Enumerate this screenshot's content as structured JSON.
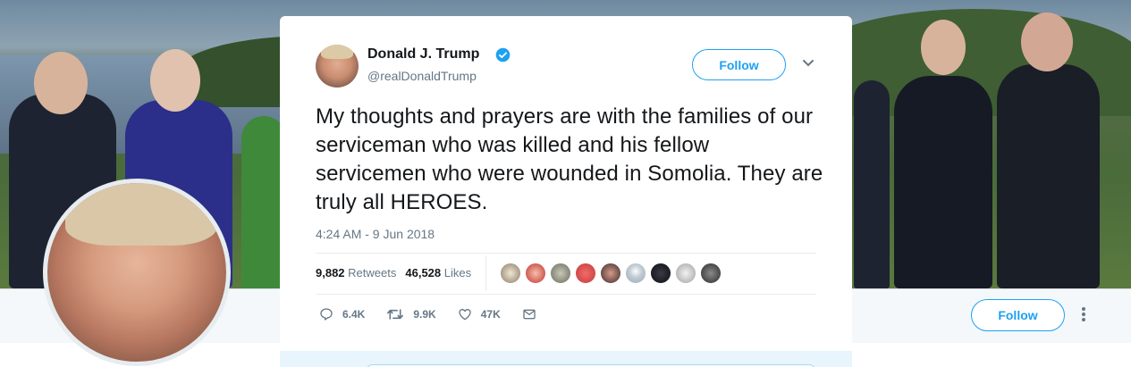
{
  "tweet": {
    "author_name": "Donald J. Trump",
    "author_handle": "@realDonaldTrump",
    "follow_label": "Follow",
    "text": "My thoughts and prayers are with the families of our serviceman who was killed and his fellow servicemen who were wounded in Somolia. They are truly all HEROES.",
    "timestamp": "4:24 AM - 9 Jun 2018",
    "retweets_count": "9,882",
    "retweets_label": "Retweets",
    "likes_count": "46,528",
    "likes_label": "Likes",
    "reply_count": "6.4K",
    "retweet_action_count": "9.9K",
    "like_action_count": "47K"
  },
  "profile": {
    "follow_label": "Follow"
  },
  "colors": {
    "accent": "#1da1f2",
    "text": "#14171a",
    "muted": "#657786"
  },
  "icons": [
    "verified-badge-icon",
    "chevron-down-icon",
    "reply-icon",
    "retweet-icon",
    "like-icon",
    "direct-message-icon",
    "more-vertical-icon"
  ]
}
